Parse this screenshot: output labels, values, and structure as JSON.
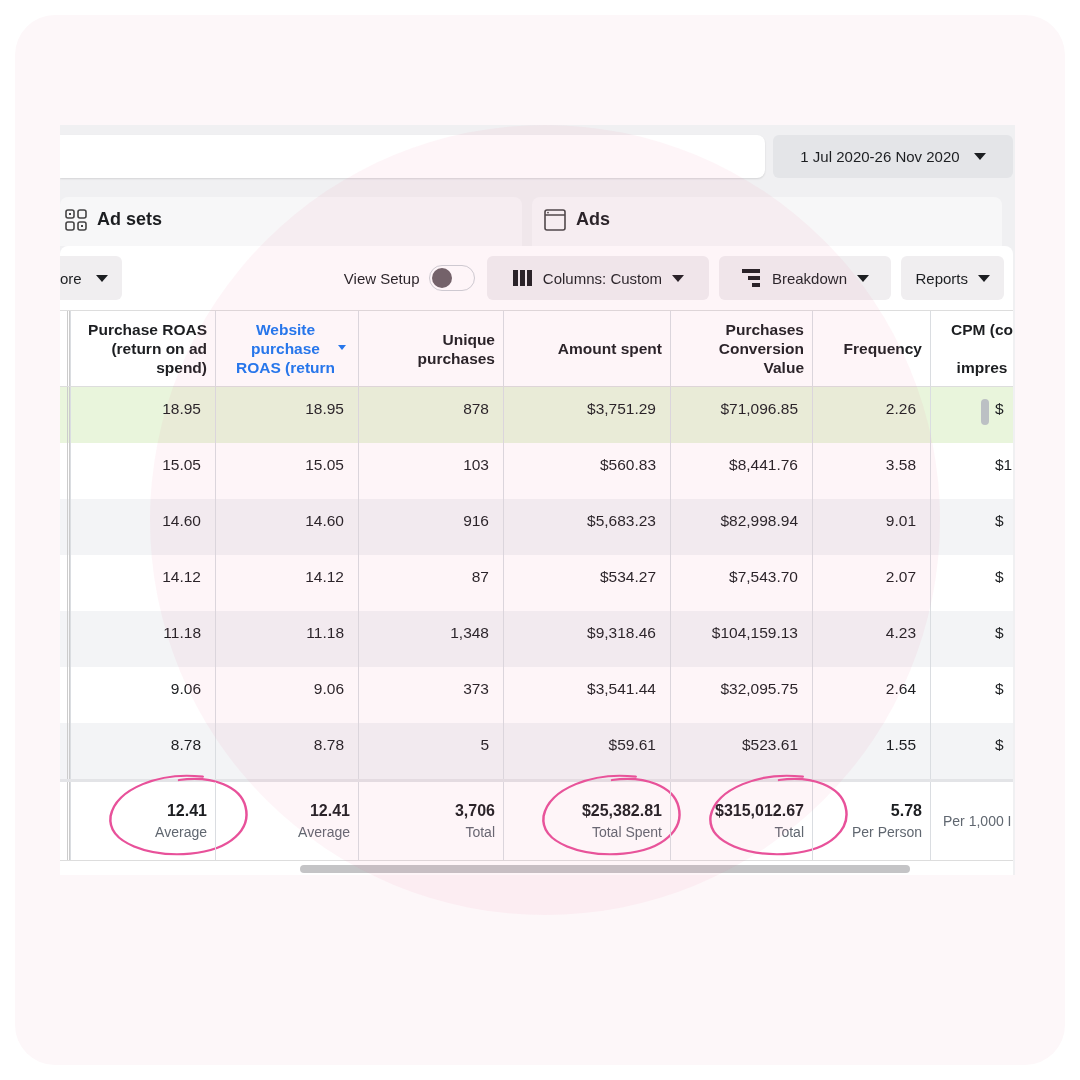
{
  "date_range": {
    "label": "1 Jul 2020-26 Nov 2020"
  },
  "tabs": [
    {
      "label": "Ad sets",
      "kind": "adsets"
    },
    {
      "label": "Ads",
      "kind": "ads"
    }
  ],
  "toolbar": {
    "more": "ore",
    "view_setup": {
      "label": "View Setup",
      "on": false
    },
    "buttons": [
      {
        "label": "Columns: Custom",
        "kind": "columns"
      },
      {
        "label": "Breakdown",
        "kind": "breakdown"
      },
      {
        "label": "Reports",
        "kind": "plain"
      }
    ]
  },
  "table": {
    "columns": [
      {
        "lines": [
          "Purchase ROAS",
          "(return on ad",
          "spend)"
        ],
        "sorted": false
      },
      {
        "lines": [
          "Website",
          "purchase",
          "ROAS (return"
        ],
        "sorted": true
      },
      {
        "lines": [
          "Unique",
          "purchases"
        ],
        "sorted": false
      },
      {
        "lines": [
          "Amount spent"
        ],
        "sorted": false
      },
      {
        "lines": [
          "Purchases",
          "Conversion",
          "Value"
        ],
        "sorted": false
      },
      {
        "lines": [
          "Frequency"
        ],
        "sorted": false
      },
      {
        "lines": [
          "CPM (co",
          "impres"
        ],
        "sorted": false
      }
    ],
    "rows": [
      {
        "highlighted": true,
        "cells": [
          "18.95",
          "18.95",
          "878",
          "$3,751.29",
          "$71,096.85",
          "2.26",
          "$"
        ]
      },
      {
        "highlighted": false,
        "cells": [
          "15.05",
          "15.05",
          "103",
          "$560.83",
          "$8,441.76",
          "3.58",
          "$1"
        ]
      },
      {
        "highlighted": false,
        "cells": [
          "14.60",
          "14.60",
          "916",
          "$5,683.23",
          "$82,998.94",
          "9.01",
          "$"
        ]
      },
      {
        "highlighted": false,
        "cells": [
          "14.12",
          "14.12",
          "87",
          "$534.27",
          "$7,543.70",
          "2.07",
          "$"
        ]
      },
      {
        "highlighted": false,
        "cells": [
          "11.18",
          "11.18",
          "1,348",
          "$9,318.46",
          "$104,159.13",
          "4.23",
          "$"
        ]
      },
      {
        "highlighted": false,
        "cells": [
          "9.06",
          "9.06",
          "373",
          "$3,541.44",
          "$32,095.75",
          "2.64",
          "$"
        ]
      },
      {
        "highlighted": false,
        "cells": [
          "8.78",
          "8.78",
          "5",
          "$59.61",
          "$523.61",
          "1.55",
          "$"
        ]
      }
    ],
    "footer": [
      {
        "value": "12.41",
        "label": "Average",
        "circled": true
      },
      {
        "value": "12.41",
        "label": "Average",
        "circled": false
      },
      {
        "value": "3,706",
        "label": "Total",
        "circled": false
      },
      {
        "value": "$25,382.81",
        "label": "Total Spent",
        "circled": true
      },
      {
        "value": "$315,012.67",
        "label": "Total",
        "circled": true
      },
      {
        "value": "5.78",
        "label": "Per Person",
        "circled": false
      },
      {
        "label": "Per 1,000 I",
        "circled": false
      }
    ]
  }
}
